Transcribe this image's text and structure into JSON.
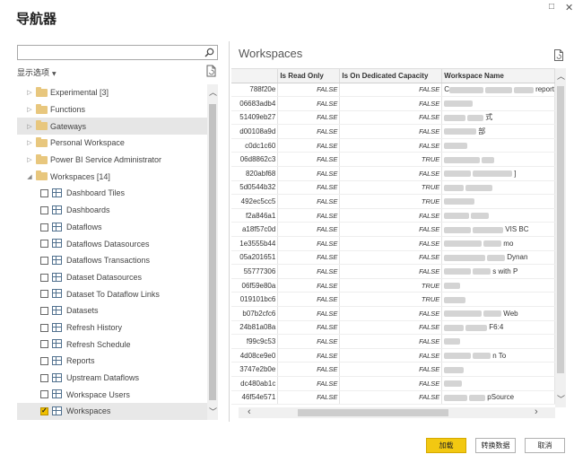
{
  "window": {
    "title": "导航器",
    "maximize_glyph": "□",
    "close_glyph": "✕"
  },
  "left": {
    "search_placeholder": "",
    "display_options_label": "显示选项",
    "tree": [
      {
        "type": "folder",
        "label": "Experimental [3]",
        "expanded": false,
        "level": 0
      },
      {
        "type": "folder",
        "label": "Functions",
        "expanded": false,
        "level": 0
      },
      {
        "type": "folder",
        "label": "Gateways",
        "expanded": false,
        "level": 0,
        "selected": true
      },
      {
        "type": "folder",
        "label": "Personal Workspace",
        "expanded": false,
        "level": 0
      },
      {
        "type": "folder",
        "label": "Power BI Service Administrator",
        "expanded": false,
        "level": 0
      },
      {
        "type": "folder",
        "label": "Workspaces [14]",
        "expanded": true,
        "level": 0
      },
      {
        "type": "table",
        "label": "Dashboard Tiles",
        "checked": false,
        "level": 1
      },
      {
        "type": "table",
        "label": "Dashboards",
        "checked": false,
        "level": 1
      },
      {
        "type": "table",
        "label": "Dataflows",
        "checked": false,
        "level": 1
      },
      {
        "type": "table",
        "label": "Dataflows Datasources",
        "checked": false,
        "level": 1
      },
      {
        "type": "table",
        "label": "Dataflows Transactions",
        "checked": false,
        "level": 1
      },
      {
        "type": "table",
        "label": "Dataset Datasources",
        "checked": false,
        "level": 1
      },
      {
        "type": "table",
        "label": "Dataset To Dataflow Links",
        "checked": false,
        "level": 1
      },
      {
        "type": "table",
        "label": "Datasets",
        "checked": false,
        "level": 1
      },
      {
        "type": "table",
        "label": "Refresh History",
        "checked": false,
        "level": 1
      },
      {
        "type": "table",
        "label": "Refresh Schedule",
        "checked": false,
        "level": 1
      },
      {
        "type": "table",
        "label": "Reports",
        "checked": false,
        "level": 1
      },
      {
        "type": "table",
        "label": "Upstream Dataflows",
        "checked": false,
        "level": 1
      },
      {
        "type": "table",
        "label": "Workspace Users",
        "checked": false,
        "level": 1
      },
      {
        "type": "table",
        "label": "Workspaces",
        "checked": true,
        "level": 1,
        "highlight": true
      }
    ]
  },
  "preview": {
    "title": "Workspaces",
    "columns": [
      "",
      "Is Read Only",
      "Is On Dedicated Capacity",
      "Workspace Name"
    ],
    "rows": [
      {
        "id": "788f20e",
        "read_only": "FALSE",
        "dedicated": "FALSE",
        "name": "C",
        "name_tail": "report"
      },
      {
        "id": "06683adb4",
        "read_only": "FALSE",
        "dedicated": "FALSE",
        "name": "",
        "name_tail": ""
      },
      {
        "id": "51409eb27",
        "read_only": "FALSE",
        "dedicated": "FALSE",
        "name": "",
        "name_tail": "式"
      },
      {
        "id": "d00108a9d",
        "read_only": "FALSE",
        "dedicated": "FALSE",
        "name": "",
        "name_tail": "部"
      },
      {
        "id": "c0dc1c60",
        "read_only": "FALSE",
        "dedicated": "FALSE",
        "name": "",
        "name_tail": ""
      },
      {
        "id": "06d8862c3",
        "read_only": "FALSE",
        "dedicated": "TRUE",
        "name": "",
        "name_tail": ""
      },
      {
        "id": "820abf68",
        "read_only": "FALSE",
        "dedicated": "FALSE",
        "name": "",
        "name_tail": "]"
      },
      {
        "id": "5d0544b32",
        "read_only": "FALSE",
        "dedicated": "TRUE",
        "name": "",
        "name_tail": ""
      },
      {
        "id": "492ec5cc5",
        "read_only": "FALSE",
        "dedicated": "TRUE",
        "name": "",
        "name_tail": ""
      },
      {
        "id": "f2a846a1",
        "read_only": "FALSE",
        "dedicated": "FALSE",
        "name": "",
        "name_tail": ""
      },
      {
        "id": "a18f57c0d",
        "read_only": "FALSE",
        "dedicated": "FALSE",
        "name": "",
        "name_tail": "VIS BC"
      },
      {
        "id": "1e3555b44",
        "read_only": "FALSE",
        "dedicated": "FALSE",
        "name": "",
        "name_tail": "mo"
      },
      {
        "id": "05a201651",
        "read_only": "FALSE",
        "dedicated": "FALSE",
        "name": "",
        "name_tail": "Dynan"
      },
      {
        "id": "55777306",
        "read_only": "FALSE",
        "dedicated": "FALSE",
        "name": "",
        "name_tail": "s with P"
      },
      {
        "id": "06f59e80a",
        "read_only": "FALSE",
        "dedicated": "TRUE",
        "name": "",
        "name_tail": ""
      },
      {
        "id": "019101bc6",
        "read_only": "FALSE",
        "dedicated": "TRUE",
        "name": "",
        "name_tail": ""
      },
      {
        "id": "b07b2cfc6",
        "read_only": "FALSE",
        "dedicated": "FALSE",
        "name": "",
        "name_tail": "Web"
      },
      {
        "id": "24b81a08a",
        "read_only": "FALSE",
        "dedicated": "FALSE",
        "name": "",
        "name_tail": "F6:4"
      },
      {
        "id": "f99c9c53",
        "read_only": "FALSE",
        "dedicated": "FALSE",
        "name": "",
        "name_tail": ""
      },
      {
        "id": "4d08ce9e0",
        "read_only": "FALSE",
        "dedicated": "FALSE",
        "name": "",
        "name_tail": "n To"
      },
      {
        "id": "3747e2b0e",
        "read_only": "FALSE",
        "dedicated": "FALSE",
        "name": "",
        "name_tail": ""
      },
      {
        "id": "dc480ab1c",
        "read_only": "FALSE",
        "dedicated": "FALSE",
        "name": "",
        "name_tail": ""
      },
      {
        "id": "46f54e571",
        "read_only": "FALSE",
        "dedicated": "FALSE",
        "name": "",
        "name_tail": "pSource"
      }
    ]
  },
  "buttons": {
    "load": "加载",
    "transform": "转换数据",
    "cancel": "取消"
  },
  "colors": {
    "accent": "#f2c811",
    "folder": "#e8c77e"
  }
}
